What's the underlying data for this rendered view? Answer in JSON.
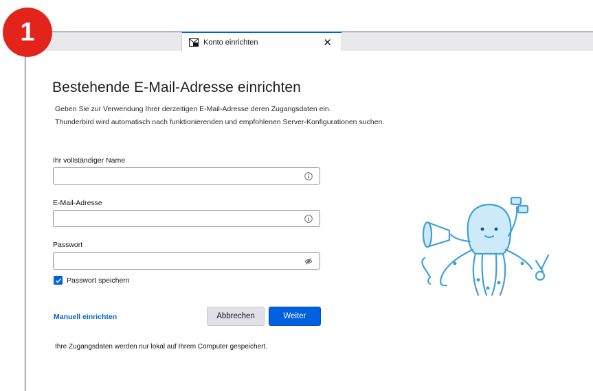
{
  "step_badge": "1",
  "tab": {
    "icon": "account-setup-icon",
    "title": "Konto einrichten",
    "close_label": "✕"
  },
  "page": {
    "title": "Bestehende E-Mail-Adresse einrichten",
    "subtitle_line1": "Geben Sie zur Verwendung Ihrer derzeitigen E-Mail-Adresse deren Zugangsdaten ein.",
    "subtitle_line2": "Thunderbird wird automatisch nach funktionierenden und empfohlenen Server-Konfigurationen suchen."
  },
  "form": {
    "name_label": "Ihr vollständiger Name",
    "name_value": "",
    "email_label": "E-Mail-Adresse",
    "email_value": "",
    "password_label": "Passwort",
    "password_value": "",
    "remember_password_label": "Passwort speichern",
    "remember_password_checked": true
  },
  "actions": {
    "manual_setup_label": "Manuell einrichten",
    "cancel_label": "Abbrechen",
    "next_label": "Weiter"
  },
  "footer_note": "Ihre Zugangsdaten werden nur lokal auf Ihrem Computer gespeichert.",
  "colors": {
    "accent": "#0060df",
    "badge": "#e3241b",
    "mascot": "#5fb8e6"
  }
}
